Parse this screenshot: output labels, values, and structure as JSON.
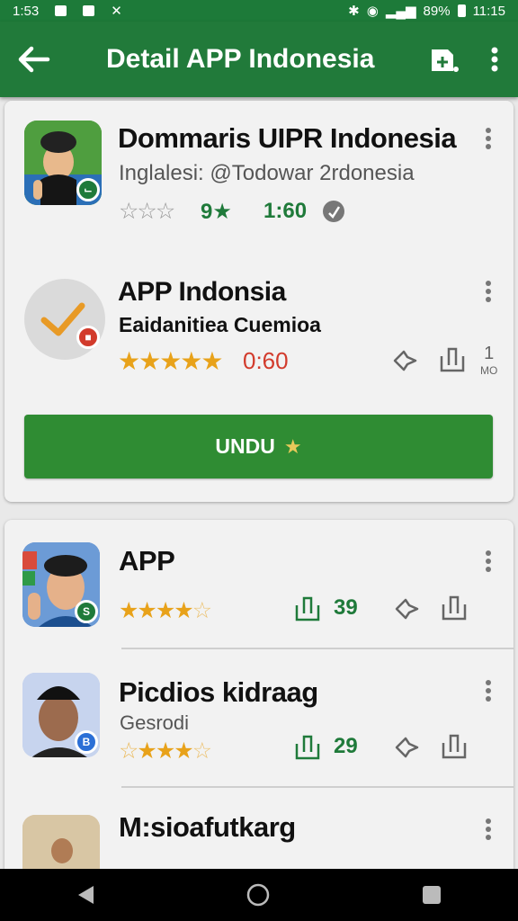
{
  "status_bar": {
    "time_left": "1:53",
    "battery": "89%",
    "time_right": "11:15"
  },
  "app_bar": {
    "title": "Detail APP Indonesia"
  },
  "featured": [
    {
      "name": "Dommaris UIPR Indonesia",
      "subtitle": "Inglalesi: @Todowar 2rdonesia",
      "rating": "9",
      "stat": "1:60",
      "stars_filled": 0
    },
    {
      "name": "APP Indonsia",
      "subtitle": "Eaidanitiea Cuemioa",
      "stat": "0:60",
      "stars_filled": 5,
      "side_count": "1",
      "side_unit": "MO"
    }
  ],
  "download_button": {
    "label": "UNDU"
  },
  "list": [
    {
      "name": "APP",
      "subtitle": "",
      "count": "39",
      "stars_filled": 4
    },
    {
      "name": "Picdios kidraag",
      "subtitle": "Gesrodi",
      "count": "29",
      "stars_filled": 4
    },
    {
      "name": "M:sioafutkarg",
      "subtitle": "",
      "count": "",
      "stars_filled": 0
    }
  ],
  "colors": {
    "primary": "#217a3a",
    "button": "#2f8c33",
    "star": "#e8a21a",
    "accent_red": "#d23b2c"
  }
}
